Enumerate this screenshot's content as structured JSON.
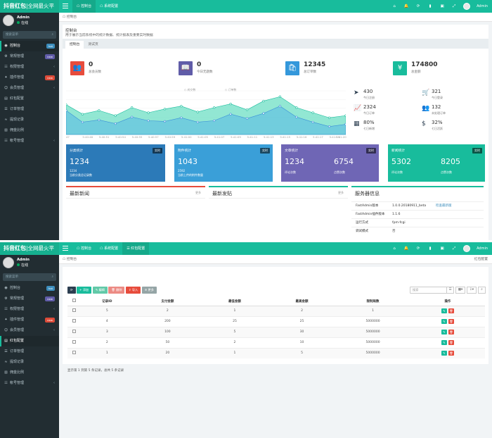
{
  "app": {
    "logo_bold": "抖音红包",
    "logo_rest": "|全网最火平"
  },
  "top1": {
    "tabs": [
      "控制台",
      "系统配置"
    ],
    "admin": "Admin"
  },
  "top2": {
    "tabs": [
      "控制台",
      "系统配置",
      "红包配置"
    ],
    "admin": "Admin"
  },
  "sidebar": {
    "name": "Admin",
    "status": "在线",
    "search_placeholder": "搜索菜单"
  },
  "menu1": [
    {
      "label": "控制台",
      "badge": "hot",
      "badge_color": "#3c8dbc",
      "active": true
    },
    {
      "label": "常规管理",
      "badge": "new",
      "badge_color": "#605ca8"
    },
    {
      "label": "权限管理",
      "caret": "‹"
    },
    {
      "label": "插件管理",
      "badge": "new",
      "badge_color": "#dd4b39"
    },
    {
      "label": "会员管理",
      "caret": "‹"
    },
    {
      "label": "红包配置"
    },
    {
      "label": "订单管理"
    },
    {
      "label": "提现记录"
    },
    {
      "label": "佣金比例"
    },
    {
      "label": "帐号管理",
      "caret": "‹"
    }
  ],
  "menu2": [
    {
      "label": "控制台",
      "badge": "hot",
      "badge_color": "#3c8dbc"
    },
    {
      "label": "常规管理",
      "badge": "new",
      "badge_color": "#605ca8"
    },
    {
      "label": "权限管理",
      "caret": "‹"
    },
    {
      "label": "插件管理",
      "badge": "new",
      "badge_color": "#dd4b39"
    },
    {
      "label": "会员管理",
      "caret": "‹"
    },
    {
      "label": "红包配置",
      "active": true
    },
    {
      "label": "订单管理"
    },
    {
      "label": "提现记录"
    },
    {
      "label": "佣金比例"
    },
    {
      "label": "帐号管理",
      "caret": "‹"
    }
  ],
  "dashboard": {
    "breadcrumb": "控制台",
    "title": "控制台",
    "subtitle": "用于展示当前系统中的统计数据、统计报表及重要实时数据",
    "tabs": [
      "控制台",
      "测试页"
    ],
    "stats": [
      {
        "value": "0",
        "label": "总会员数",
        "color": "#e74c3c",
        "icon": "users-icon",
        "glyph": "👥"
      },
      {
        "value": "0",
        "label": "今日无题数",
        "color": "#605ca8",
        "icon": "book-icon",
        "glyph": "📖"
      },
      {
        "value": "12345",
        "label": "总订单数",
        "color": "#3498db",
        "icon": "cart-icon",
        "glyph": "🛍"
      },
      {
        "value": "174800",
        "label": "总金额",
        "color": "#18bc9c",
        "icon": "yen-icon",
        "glyph": "¥"
      }
    ],
    "legend": [
      "成交数",
      "订单数"
    ],
    "chart_data": {
      "type": "area",
      "x": [
        "47",
        "5:40:46",
        "5:40:51",
        "5:40:54",
        "5:40:55",
        "5:40:57",
        "5:40:59",
        "5:41:00",
        "5:41:05",
        "5:41:07",
        "5:41:09",
        "5:41:11",
        "5:41:13",
        "5:41:15",
        "5:41:16",
        "5:41:17",
        "5:41:19",
        "5:41:20"
      ],
      "series": [
        {
          "name": "成交数",
          "values": [
            205,
            140,
            165,
            130,
            185,
            150,
            175,
            195,
            155,
            185,
            210,
            170,
            230,
            260,
            185,
            150,
            115,
            130
          ]
        },
        {
          "name": "订单数",
          "values": [
            165,
            85,
            100,
            75,
            120,
            95,
            90,
            115,
            85,
            95,
            140,
            110,
            145,
            195,
            120,
            85,
            55,
            70
          ]
        }
      ],
      "ylim": [
        0,
        300
      ]
    },
    "mini": [
      {
        "value": "430",
        "label": "今日注册",
        "icon": "plane-icon",
        "glyph": "➤"
      },
      {
        "value": "321",
        "label": "今日登录",
        "icon": "cart2-icon",
        "glyph": "🛒"
      },
      {
        "value": "2324",
        "label": "今日订单",
        "icon": "line-chart-icon",
        "glyph": "📈"
      },
      {
        "value": "132",
        "label": "未处理订单",
        "icon": "group-icon",
        "glyph": "👥"
      },
      {
        "value": "80%",
        "label": "七日新增",
        "icon": "calendar-icon",
        "glyph": "▦"
      },
      {
        "value": "32%",
        "label": "七日活跃",
        "icon": "dollar-icon",
        "glyph": "$"
      }
    ],
    "cards": [
      {
        "title": "分类统计",
        "tag": "实时",
        "big": "1234",
        "sub": "1234",
        "sub2": "当前分类总记录数",
        "color": "#2c7ab8"
      },
      {
        "title": "附件统计",
        "tag": "实时",
        "big": "1043",
        "sub": "2592",
        "sub2": "当前上传的附件数量",
        "color": "#3a9fd8"
      },
      {
        "title": "文章统计",
        "tag": "实时",
        "big1": "1234",
        "big2": "6754",
        "sub_l": "评论次数",
        "sub_r": "点赞次数",
        "color": "#6f66b5"
      },
      {
        "title": "新闻统计",
        "tag": "实时",
        "big1": "5302",
        "big2": "8205",
        "sub_l": "评论次数",
        "sub_r": "点赞次数",
        "color": "#18bc9c"
      }
    ],
    "info": [
      {
        "title": "最新新闻",
        "more": "更多"
      },
      {
        "title": "最新发贴",
        "more": "更多"
      }
    ],
    "server": {
      "title": "服务器信息",
      "rows": [
        {
          "k": "FastAdmin版本",
          "v": "1.0.0.20180911_beta",
          "link": "检查最新版"
        },
        {
          "k": "FastAdmin插件版本",
          "v": "1.1.6"
        },
        {
          "k": "运行方式",
          "v": "fpm-fcgi"
        },
        {
          "k": "调试模式",
          "v": "否"
        }
      ]
    }
  },
  "redpacket": {
    "breadcrumb": "控制台",
    "breadcrumb_right": "红包配置",
    "toolbar": [
      {
        "label": "⟳",
        "color": "#2c3e50"
      },
      {
        "label": "+ 添加",
        "color": "#18bc9c"
      },
      {
        "label": "✎ 编辑",
        "color": "#62c9a8"
      },
      {
        "label": "🗑 删除",
        "color": "#ec8b84"
      },
      {
        "label": "⇪ 导入",
        "color": "#e74c3c"
      },
      {
        "label": "≡ 更多",
        "color": "#95a5a6"
      }
    ],
    "search_placeholder": "搜索",
    "columns": [
      "",
      "记录ID",
      "支付金额",
      "最低金额",
      "最高金额",
      "限制局数",
      "操作"
    ],
    "rows": [
      [
        "5",
        "2",
        "1",
        "2",
        "1"
      ],
      [
        "4",
        "200",
        "25",
        "25",
        "5000000"
      ],
      [
        "3",
        "100",
        "5",
        "30",
        "5000000"
      ],
      [
        "2",
        "50",
        "2",
        "10",
        "5000000"
      ],
      [
        "1",
        "20",
        "1",
        "5",
        "5000000"
      ]
    ],
    "footer": "显示第 1 到第 5 条记录，总共 5 条记录"
  }
}
